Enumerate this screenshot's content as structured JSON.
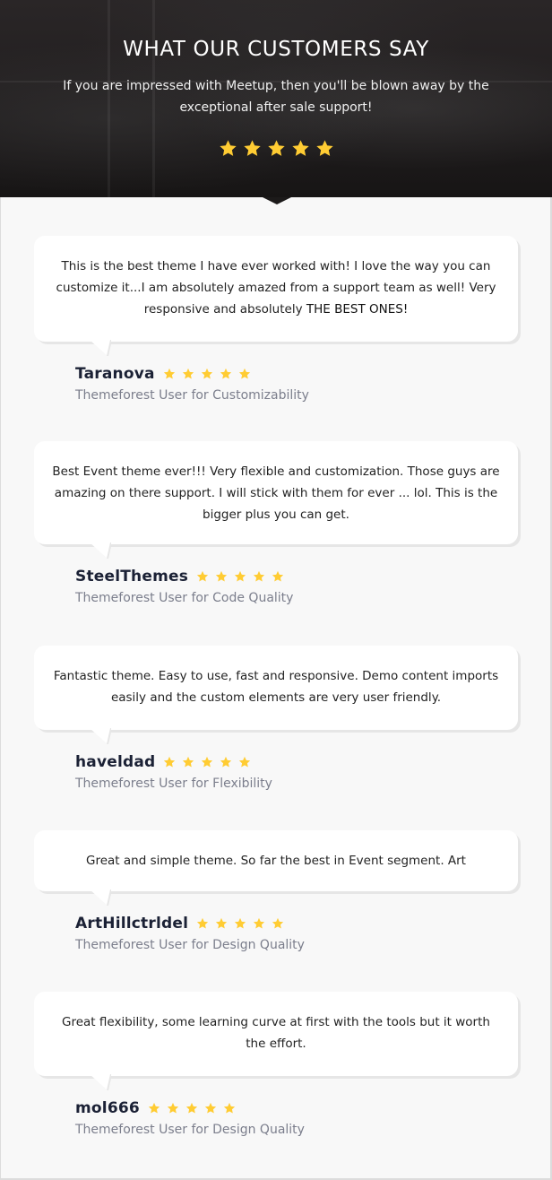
{
  "hero": {
    "title": "WHAT OUR CUSTOMERS SAY",
    "subtitle": "If you are impressed with Meetup, then you'll be blown away by the exceptional after sale support!",
    "rating": 5,
    "star_color": "#ffcc33"
  },
  "testimonials": [
    {
      "quote": "This is the best theme I have ever worked with! I love the way you can customize it...I am absolutely amazed from a support team as well! Very responsive and absolutely",
      "quote_emphasis": "THE BEST ONES!",
      "author": "Taranova",
      "rating": 5,
      "role": "Themeforest User for Customizability"
    },
    {
      "quote": "Best Event theme ever!!! Very flexible and customization. Those guys are amazing on there support. I will stick with them for ever ... lol. This is the bigger plus you can get.",
      "quote_emphasis": "",
      "author": "SteelThemes",
      "rating": 5,
      "role": "Themeforest User for Code Quality"
    },
    {
      "quote": "Fantastic theme. Easy to use, fast and responsive. Demo content imports easily and the custom elements are very user friendly.",
      "quote_emphasis": "",
      "author": "haveldad",
      "rating": 5,
      "role": "Themeforest User for Flexibility"
    },
    {
      "quote": "Great and simple theme. So far the best in Event segment. Art",
      "quote_emphasis": "",
      "author": "ArtHillctrldel",
      "rating": 5,
      "role": "Themeforest User for Design Quality"
    },
    {
      "quote": "Great flexibility, some learning curve at first with the tools but it worth the effort.",
      "quote_emphasis": "",
      "author": "mol666",
      "rating": 5,
      "role": "Themeforest User for Design Quality"
    }
  ]
}
